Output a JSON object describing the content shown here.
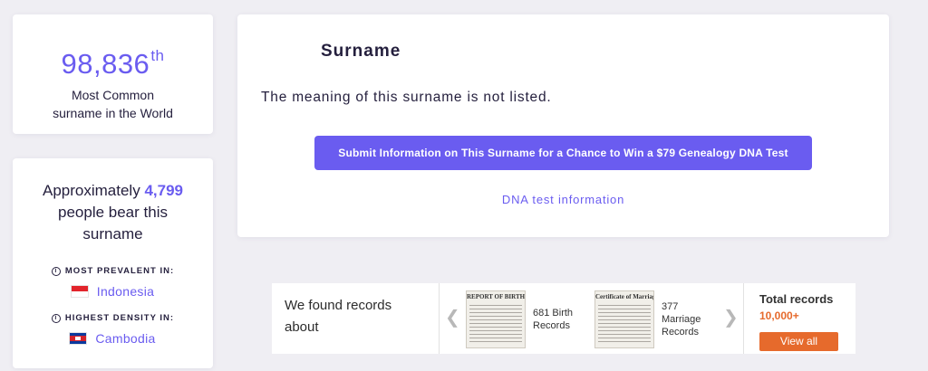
{
  "rank": {
    "number": "98,836",
    "suffix": "th",
    "caption_line1": "Most Common",
    "caption_line2": "surname in the World"
  },
  "bearers": {
    "prefix": "Approximately",
    "count": "4,799",
    "suffix_line1": "people bear this",
    "suffix_line2": "surname",
    "prevalent_label": "MOST PREVALENT IN:",
    "prevalent_country": "Indonesia",
    "density_label": "HIGHEST DENSITY IN:",
    "density_country": "Cambodia"
  },
  "main": {
    "title": "Surname",
    "meaning": "The meaning of this surname is not listed.",
    "submit_label": "Submit Information on This Surname for a Chance to Win a $79 Genealogy DNA Test",
    "dna_link": "DNA test information"
  },
  "records": {
    "intro": "We found records about",
    "birth_thumb_heading": "REPORT OF BIRTH",
    "birth_label": "681 Birth Records",
    "marriage_thumb_heading": "Certificate of Marriage",
    "marriage_label": "377 Marriage Records",
    "total_title": "Total records",
    "total_count": "10,000+",
    "view_all": "View all"
  },
  "icons": {
    "info": "info-circle-icon",
    "prev": "chevron-left-icon",
    "next": "chevron-right-icon"
  },
  "colors": {
    "accent": "#6a5cf0",
    "orange": "#e66a2c",
    "background": "#efeef3"
  }
}
